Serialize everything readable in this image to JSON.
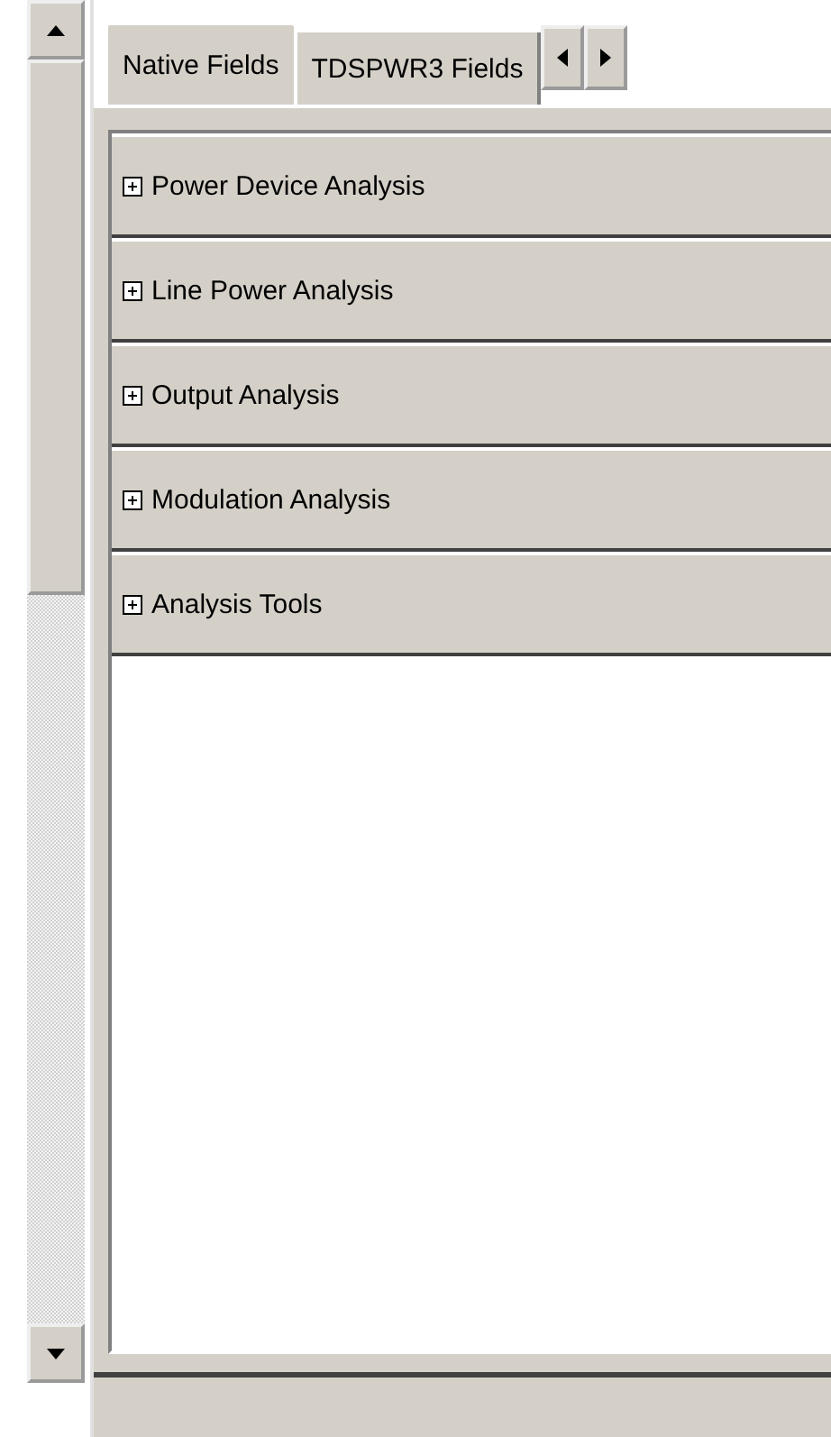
{
  "tabs": [
    {
      "label": "Native Fields",
      "selected": true
    },
    {
      "label": "TDSPWR3 Fields",
      "selected": false
    }
  ],
  "groups": [
    {
      "label": "Power Device Analysis",
      "expanded": false
    },
    {
      "label": "Line Power Analysis",
      "expanded": false
    },
    {
      "label": "Output Analysis",
      "expanded": false
    },
    {
      "label": "Modulation Analysis",
      "expanded": false
    },
    {
      "label": "Analysis Tools",
      "expanded": false
    }
  ]
}
